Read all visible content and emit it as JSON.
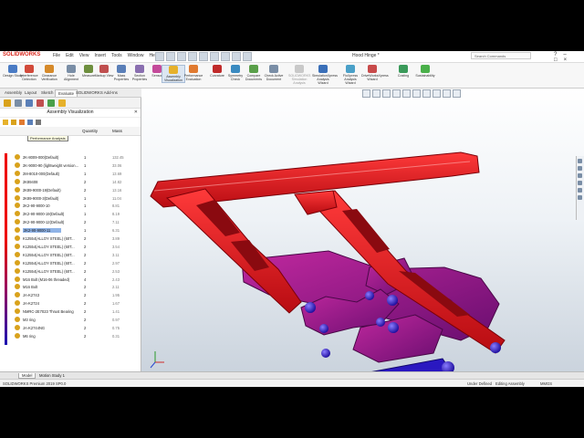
{
  "window": {
    "brand": "SOLIDWORKS",
    "menu": [
      "File",
      "Edit",
      "View",
      "Insert",
      "Tools",
      "Window",
      "Help"
    ],
    "doc_title": "Hood Hinge *",
    "search_placeholder": "Search Commands",
    "controls": [
      "?",
      "–",
      "□",
      "×"
    ]
  },
  "ribbon": {
    "buttons": [
      {
        "label": "Design Study",
        "color": "#4a7bc4"
      },
      {
        "label": "Interference Detection",
        "color": "#d24a3a"
      },
      {
        "label": "Clearance Verification",
        "color": "#d68a2a"
      },
      {
        "label": "Hole Alignment",
        "color": "#7a8ea6"
      },
      {
        "label": "Measure",
        "color": "#6e8f3e"
      },
      {
        "label": "Markup View",
        "color": "#c04f4f"
      },
      {
        "label": "Mass Properties",
        "color": "#5a7fb8"
      },
      {
        "label": "Section Properties",
        "color": "#8a6fb0"
      },
      {
        "label": "Sensor",
        "color": "#c44a9a"
      },
      {
        "label": "Assembly Visualization",
        "color": "#e6b12b",
        "active": true
      },
      {
        "label": "Performance Evaluation",
        "color": "#e07a30"
      },
      {
        "label": "Curvature",
        "color": "#c02a2a"
      },
      {
        "label": "Symmetry Check",
        "color": "#3a8ac0"
      },
      {
        "label": "Compare Documents",
        "color": "#5aa04a"
      },
      {
        "label": "Check Active Document",
        "color": "#7a8ea6"
      },
      {
        "label": "SOLIDWORKS Simulation Analysis",
        "color": "#c9c9c9",
        "grey": true
      },
      {
        "label": "SimulationXpress Analysis Wizard",
        "color": "#3a6fb8"
      },
      {
        "label": "FloXpress Analysis Wizard",
        "color": "#4aa0c8"
      },
      {
        "label": "DriveWorksXpress Wizard",
        "color": "#c84a4a"
      },
      {
        "label": "Costing",
        "color": "#3a9a5a"
      },
      {
        "label": "Sustainability",
        "color": "#4ab04a"
      }
    ]
  },
  "tabs": [
    "Assembly",
    "Layout",
    "Sketch",
    "Evaluate",
    "SOLIDWORKS Add-Ins"
  ],
  "active_tab": "Evaluate",
  "panel": {
    "title": "Assembly Visualization",
    "tooltip": "Performance Analysis",
    "columns": {
      "name": "",
      "quantity": "Quantity",
      "mass": "Mass"
    },
    "rows": [
      {
        "name": "2K-8009-000(Default)",
        "qty": "1",
        "mass": "132.45",
        "color": "#e11"
      },
      {
        "name": "2K-9000-90 (lightweight version...",
        "qty": "1",
        "mass": "33.06",
        "color": "#e11"
      },
      {
        "name": "2M-8010-000(Default)",
        "qty": "1",
        "mass": "13.69",
        "color": "#e21"
      },
      {
        "name": "2K89408",
        "qty": "2",
        "mass": "14.82",
        "color": "#e21"
      },
      {
        "name": "2K89-9000-19(Default)",
        "qty": "2",
        "mass": "13.16",
        "color": "#e21"
      },
      {
        "name": "2K89-9000-3(Default)",
        "qty": "1",
        "mass": "11.04",
        "color": "#e21"
      },
      {
        "name": "2K2-90-9000-10",
        "qty": "1",
        "mass": "8.81",
        "color": "#e22"
      },
      {
        "name": "2K2-90-9000-19(Default)",
        "qty": "1",
        "mass": "8.19",
        "color": "#e22"
      },
      {
        "name": "2K2-90-9000-12(Default)",
        "qty": "2",
        "mass": "7.11",
        "color": "#e22"
      },
      {
        "name": "2K2-90-9000-11",
        "qty": "1",
        "mass": "6.31",
        "color": "#d23",
        "selected": true
      },
      {
        "name": "K12554(ALLOY STEEL) (60T...",
        "qty": "2",
        "mass": "3.89",
        "color": "#c23"
      },
      {
        "name": "K12554(ALLOY STEEL) (60T...",
        "qty": "2",
        "mass": "3.54",
        "color": "#c24"
      },
      {
        "name": "K12554(ALLOY STEEL) (60T...",
        "qty": "2",
        "mass": "3.11",
        "color": "#b25"
      },
      {
        "name": "K12554(ALLOY STEEL) (60T...",
        "qty": "2",
        "mass": "2.97",
        "color": "#a26"
      },
      {
        "name": "K12554(ALLOY STEEL) (60T...",
        "qty": "2",
        "mass": "2.53",
        "color": "#a27"
      },
      {
        "name": "M16 Bolt (M16-06 threaded)",
        "qty": "4",
        "mass": "2.43",
        "color": "#92a"
      },
      {
        "name": "M16 Bolt",
        "qty": "2",
        "mass": "2.11",
        "color": "#72b"
      },
      {
        "name": "JA-K2743",
        "qty": "2",
        "mass": "1.95",
        "color": "#52c"
      },
      {
        "name": "JA-K2724",
        "qty": "2",
        "mass": "1.67",
        "color": "#42d"
      },
      {
        "name": "NMRC-2E7023 Thrust Bearing",
        "qty": "2",
        "mass": "1.41",
        "color": "#32d"
      },
      {
        "name": "M3 ring",
        "qty": "2",
        "mass": "0.97",
        "color": "#22e"
      },
      {
        "name": "JA-K2744NG",
        "qty": "2",
        "mass": "0.75",
        "color": "#22e"
      },
      {
        "name": "M6 ring",
        "qty": "2",
        "mass": "0.31",
        "color": "#11e"
      }
    ]
  },
  "bottom_tabs": [
    "Model",
    "Motion Study 1"
  ],
  "status": {
    "app": "SOLIDWORKS Premium 2019 SP0.0",
    "state": "Under Defined",
    "mode": "Editing Assembly",
    "units": "MMGS"
  },
  "colors": {
    "part_red": "#e8141c",
    "part_magenta": "#9b1a8f",
    "part_blue": "#2a1ac8"
  }
}
